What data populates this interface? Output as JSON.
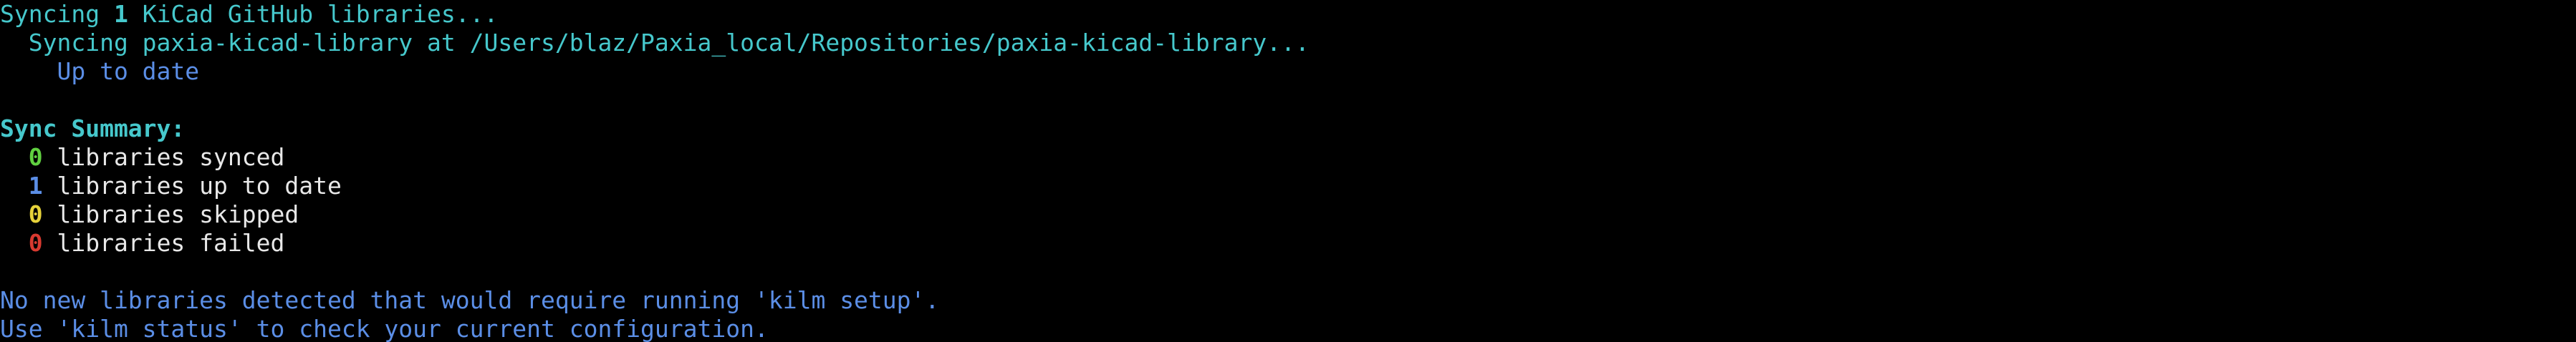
{
  "colors": {
    "background": "#000000",
    "cyan": "#46c8cc",
    "blue": "#5b8ee6",
    "white": "#e8e8e8",
    "green": "#60d040",
    "yellow": "#e6d23a",
    "red": "#d93a30"
  },
  "sync": {
    "header_prefix": "Syncing ",
    "header_count": "1",
    "header_suffix": " KiCad GitHub libraries...",
    "repo_line": "  Syncing paxia-kicad-library at /Users/blaz/Paxia_local/Repositories/paxia-kicad-library...",
    "repo_status": "    Up to date"
  },
  "summary": {
    "title": "Sync Summary:",
    "rows": [
      {
        "count": "0",
        "label": " libraries synced",
        "color": "#60d040"
      },
      {
        "count": "1",
        "label": " libraries up to date",
        "color": "#5b8ee6"
      },
      {
        "count": "0",
        "label": " libraries skipped",
        "color": "#e6d23a"
      },
      {
        "count": "0",
        "label": " libraries failed",
        "color": "#d93a30"
      }
    ]
  },
  "footer": {
    "line1": "No new libraries detected that would require running 'kilm setup'.",
    "line2": "Use 'kilm status' to check your current configuration."
  }
}
